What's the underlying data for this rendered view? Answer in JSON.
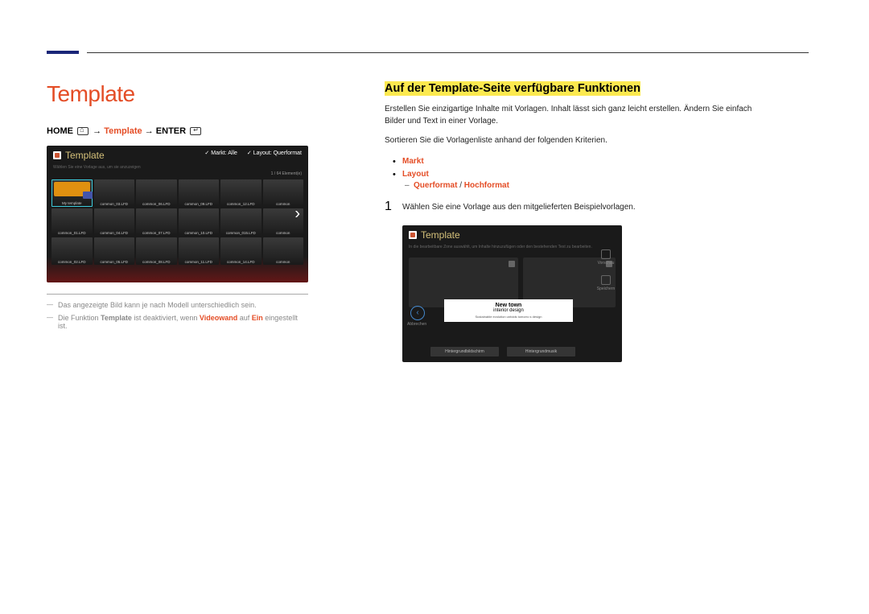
{
  "page": {
    "heading": "Template",
    "breadcrumb": {
      "home_label": "HOME",
      "arrow": "→",
      "template_label": "Template",
      "enter_label": "ENTER"
    }
  },
  "screenshot1": {
    "title": "Template",
    "subtitle": "Wählen Sie eine Vorlage aus, um sie anzuzeigen",
    "dropdown_market_label": "Markt: Alle",
    "dropdown_layout_label": "Layout: Querformat",
    "counter": "1 / 64 Element(e)",
    "chevron": "›",
    "thumbs": [
      {
        "label": "My template"
      },
      {
        "label": "common_03.LFD"
      },
      {
        "label": "common_06.LFD"
      },
      {
        "label": "common_09.LFD"
      },
      {
        "label": "common_12.LFD"
      },
      {
        "label": "common"
      },
      {
        "label": "common_01.LFD"
      },
      {
        "label": "common_04.LFD"
      },
      {
        "label": "common_07.LFD"
      },
      {
        "label": "common_10.LFD"
      },
      {
        "label": "common_015.LFD"
      },
      {
        "label": "common"
      },
      {
        "label": "common_02.LFD"
      },
      {
        "label": "common_05.LFD"
      },
      {
        "label": "common_08.LFD"
      },
      {
        "label": "common_11.LFD"
      },
      {
        "label": "common_14.LFD"
      },
      {
        "label": "common"
      }
    ]
  },
  "notes": {
    "line1_prefix": "Das angezeigte Bild kann je nach Modell unterschiedlich sein.",
    "line2_a": "Die Funktion ",
    "line2_b": "Template",
    "line2_c": " ist deaktiviert, wenn ",
    "line2_d": "Videowand",
    "line2_e": " auf ",
    "line2_f": "Ein",
    "line2_g": " eingestellt ist."
  },
  "section": {
    "heading": "Auf der Template-Seite verfügbare Funktionen",
    "para1": "Erstellen Sie einzigartige Inhalte mit Vorlagen. Inhalt lässt sich ganz leicht erstellen. Ändern Sie einfach Bilder und Text in einer Vorlage.",
    "para2": "Sortieren Sie die Vorlagenliste anhand der folgenden Kriterien.",
    "bullet1": "Markt",
    "bullet2": "Layout",
    "sub_a": "Querformat",
    "sub_sep": " / ",
    "sub_b": "Hochformat",
    "step1_num": "1",
    "step1_text": "Wählen Sie eine Vorlage aus den mitgelieferten Beispielvorlagen."
  },
  "screenshot2": {
    "title": "Template",
    "subtitle": "In die bearbeitbare Zone auswählt, um Inhalte hinzuzufügen oder den bestehenden Text zu bearbeiten.",
    "side_preview": "Vorschau",
    "side_save": "Speichern",
    "back_label": "Abbrechen",
    "back_arrow": "‹",
    "textbox_title": "New town",
    "textbox_sub": "interior design",
    "textbox_small": "Sustainable evolution unfolds tomorro s design",
    "bottom1": "Hintergrundbildschirm",
    "bottom2": "Hintergrundmusik"
  }
}
